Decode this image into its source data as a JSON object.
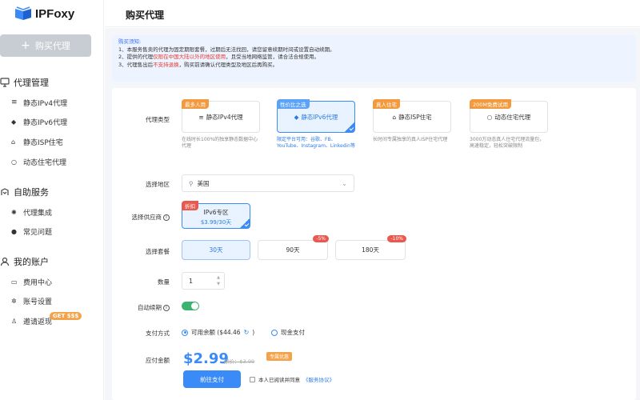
{
  "brand": {
    "name": "IPFoxy",
    "accent": "#3a8bf7"
  },
  "sidebar": {
    "buy_button": "购买代理",
    "groups": [
      {
        "title": "代理管理",
        "icon": "proxy-icon"
      },
      {
        "title": "自助服务",
        "icon": "service-icon"
      },
      {
        "title": "我的账户",
        "icon": "user-icon"
      }
    ],
    "items": [
      {
        "label": "静态IPv4代理",
        "icon": "list-icon"
      },
      {
        "label": "静态IPv6代理",
        "icon": "layers-icon"
      },
      {
        "label": "静态ISP住宅",
        "icon": "home-icon"
      },
      {
        "label": "动态住宅代理",
        "icon": "refresh-icon"
      },
      {
        "label": "代理集成",
        "icon": "gear-icon"
      },
      {
        "label": "常见问题",
        "icon": "help-icon"
      },
      {
        "label": "费用中心",
        "icon": "card-icon"
      },
      {
        "label": "账号设置",
        "icon": "settings-icon"
      },
      {
        "label": "邀请返现",
        "icon": "gift-icon"
      }
    ],
    "invite_badge": "GET $$$"
  },
  "header": {
    "title": "购买代理"
  },
  "notice": {
    "title": "购买须知:",
    "line1": "1、本服务售卖的代理为固定期限套餐，过期后无法找回，请您留意续期时间或设置自动续期。",
    "line2a": "2、提供的代理",
    "line2b": "仅限在中国大陆以外的地区使用",
    "line2c": "，且受当地网络监管，请合法合规使用。",
    "line3a": "3、代理售出后",
    "line3b": "不支持退换",
    "line3c": "，购买前请确认代理类型及地区后再购买。"
  },
  "form": {
    "type_label": "代理类型",
    "types": [
      {
        "tag": "最多人用",
        "label": "静态IPv4代理",
        "desc": "在线时长100%的独享静态数据中心代理"
      },
      {
        "tag": "性价比之选",
        "label": "静态IPv6代理",
        "desc": "限定平台可用：谷歌、FB、YouTube、Instagram、Linkedin等"
      },
      {
        "tag": "真人住宅",
        "label": "静态ISP住宅",
        "desc": "长时间专属独享的真人ISP住宅代理"
      },
      {
        "tag": "200M免费试用",
        "label": "动态住宅代理",
        "desc": "3000万动态真人住宅代理流量包，高速稳定，轻松突破限制"
      }
    ],
    "region_label": "选择地区",
    "region_value": "美国",
    "provider_label": "选择供应商",
    "provider": {
      "tag": "折扣",
      "name": "IPv6专区",
      "price": "$3.99/30天"
    },
    "plan_label": "选择套餐",
    "plans": [
      {
        "label": "30天",
        "discount": ""
      },
      {
        "label": "90天",
        "discount": "-5%"
      },
      {
        "label": "180天",
        "discount": "-10%"
      }
    ],
    "qty_label": "数量",
    "qty_value": "1",
    "auto_renew_label": "自动续期",
    "auto_renew_on": true,
    "pay_method_label": "支付方式",
    "pay_balance": "可用余额 ($44.46",
    "pay_cash": "现金支付",
    "amount_label": "应付金额",
    "amount": "$2.99",
    "original": "原价：$3.99",
    "promo": "专属优惠",
    "pay_button": "前往支付",
    "agree_text": "本人已阅读并同意",
    "agree_link": "《服务协议》"
  }
}
